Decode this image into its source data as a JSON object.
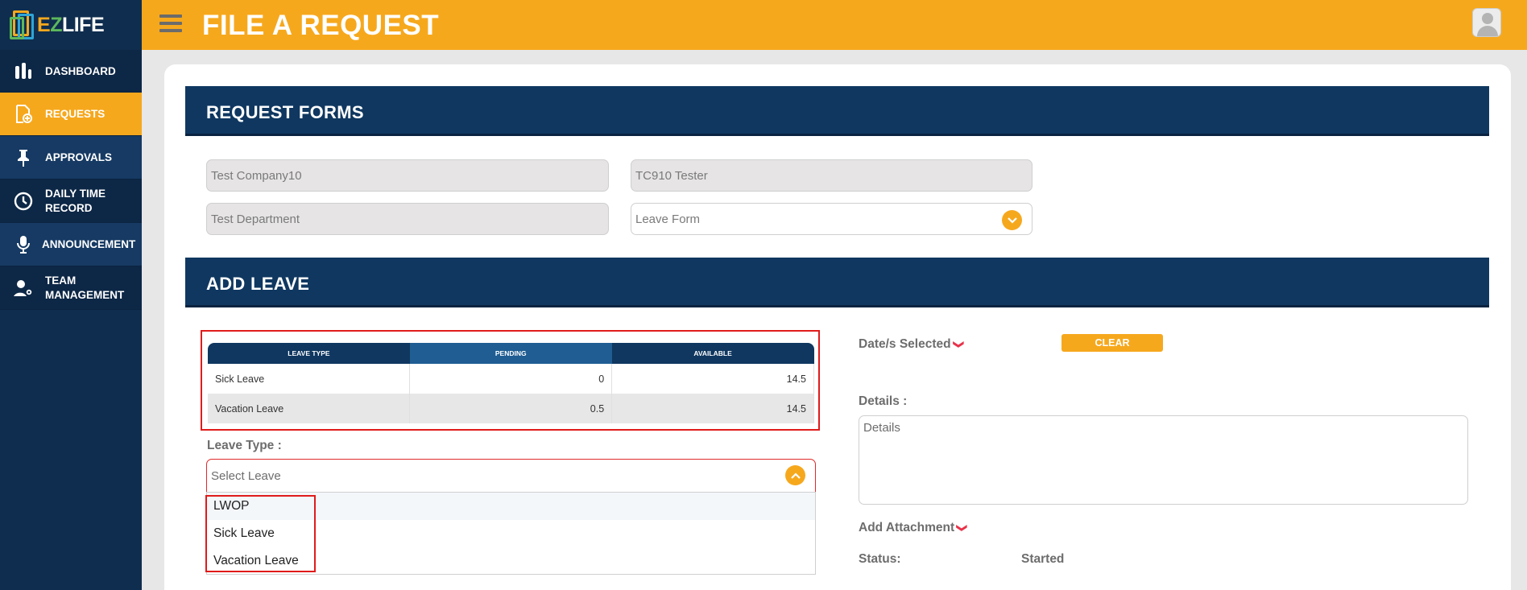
{
  "app": {
    "logo_text_e": "E",
    "logo_text_z": "Z",
    "logo_text_life": "LIFE"
  },
  "topbar": {
    "title": "FILE A REQUEST"
  },
  "sidebar": {
    "items": [
      {
        "label": "DASHBOARD",
        "icon": "bar-chart-icon"
      },
      {
        "label": "REQUESTS",
        "icon": "document-add-icon"
      },
      {
        "label": "APPROVALS",
        "icon": "pin-icon"
      },
      {
        "label_line1": "DAILY TIME",
        "label_line2": "RECORD",
        "icon": "clock-icon"
      },
      {
        "label": "ANNOUNCEMENT",
        "icon": "microphone-icon"
      },
      {
        "label_line1": "TEAM",
        "label_line2": "MANAGEMENT",
        "icon": "user-gear-icon"
      }
    ]
  },
  "request_forms": {
    "title": "REQUEST FORMS",
    "company": "Test Company10",
    "employee": "TC910 Tester",
    "department": "Test Department",
    "form_type": "Leave Form"
  },
  "add_leave": {
    "title": "ADD LEAVE",
    "table": {
      "headers": [
        "LEAVE TYPE",
        "PENDING",
        "AVAILABLE"
      ],
      "rows": [
        {
          "type": "Sick Leave",
          "pending": "0",
          "available": "14.5"
        },
        {
          "type": "Vacation Leave",
          "pending": "0.5",
          "available": "14.5"
        }
      ]
    },
    "leave_type_label": "Leave Type :",
    "leave_type_placeholder": "Select Leave",
    "leave_options": [
      "LWOP",
      "Sick Leave",
      "Vacation Leave"
    ],
    "dates_label": "Date/s Selected",
    "clear_label": "CLEAR",
    "details_label": "Details :",
    "details_placeholder": "Details",
    "attachment_label": "Add Attachment",
    "status_label": "Status:",
    "status_value": "Started"
  },
  "colors": {
    "accent": "#f6a81d",
    "navy": "#0f3760",
    "sidebar": "#0f2d4e",
    "highlight": "#e01b1b"
  }
}
